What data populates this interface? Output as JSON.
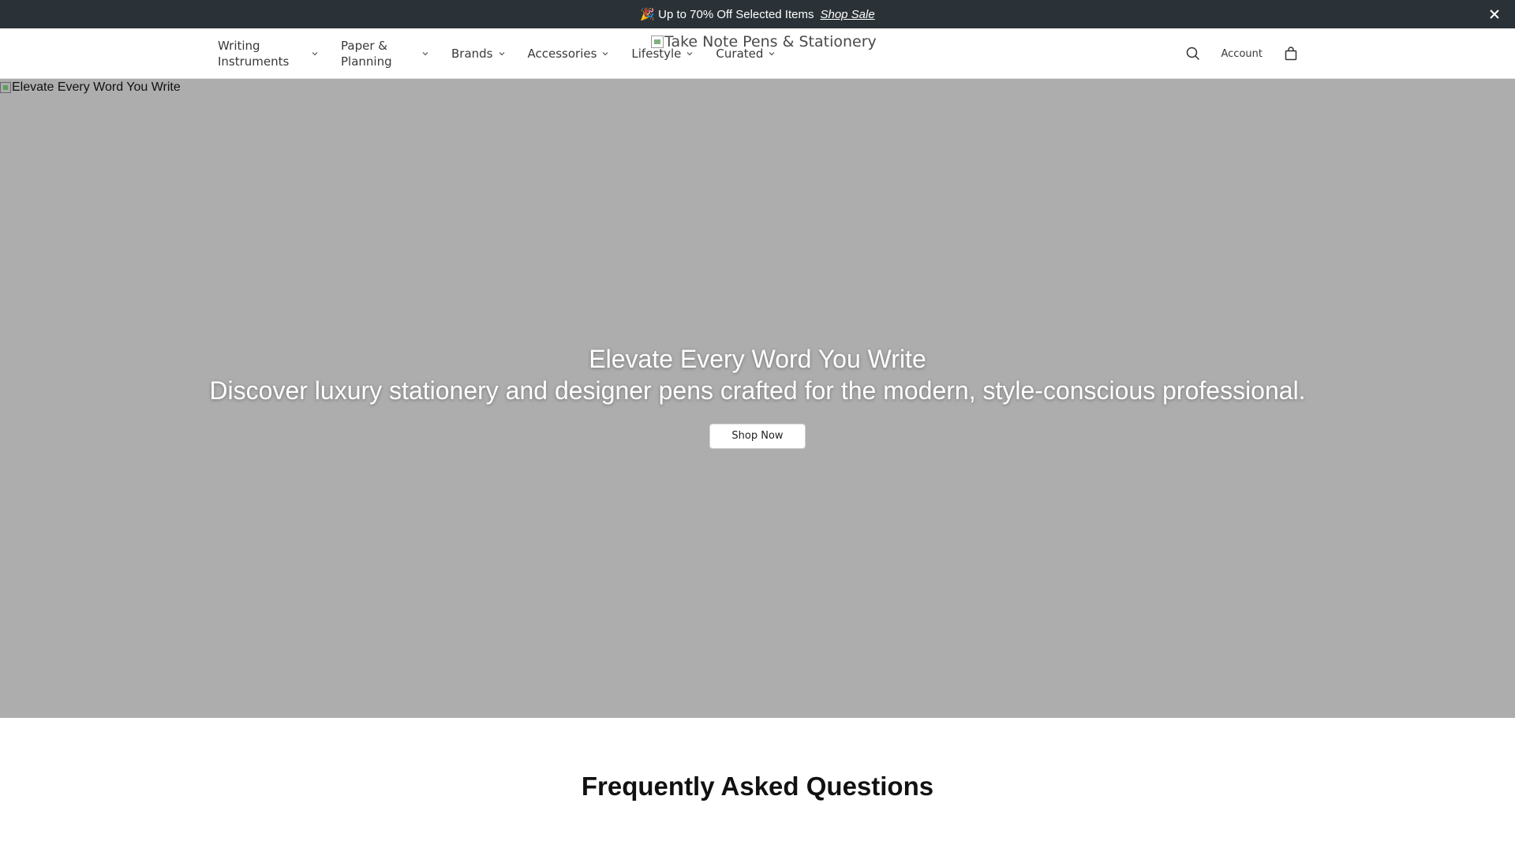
{
  "announcement": {
    "message": "🎉 Up to 70% Off Selected Items",
    "link_label": "Shop Sale",
    "close_label": "✕"
  },
  "header": {
    "logo_alt": "Take Note Pens & Stationery",
    "nav": [
      {
        "label": "Writing Instruments"
      },
      {
        "label": "Paper & Planning"
      },
      {
        "label": "Brands"
      },
      {
        "label": "Accessories"
      },
      {
        "label": "Lifestyle"
      },
      {
        "label": "Curated"
      }
    ],
    "account_label": "Account",
    "icons": {
      "search": "search-icon",
      "cart": "shopping-bag-icon",
      "chevron": "chevron-down-icon"
    }
  },
  "hero": {
    "image_alt": "Elevate Every Word You Write",
    "title": "Elevate Every Word You Write",
    "subtitle": "Discover luxury stationery and designer pens crafted for the modern, style-conscious professional.",
    "button_label": "Shop Now"
  },
  "faq": {
    "title": "Frequently Asked Questions"
  },
  "colors": {
    "announcement_bg": "#2a3237",
    "hero_bg": "#adadad",
    "header_bg": "#ffffff"
  }
}
